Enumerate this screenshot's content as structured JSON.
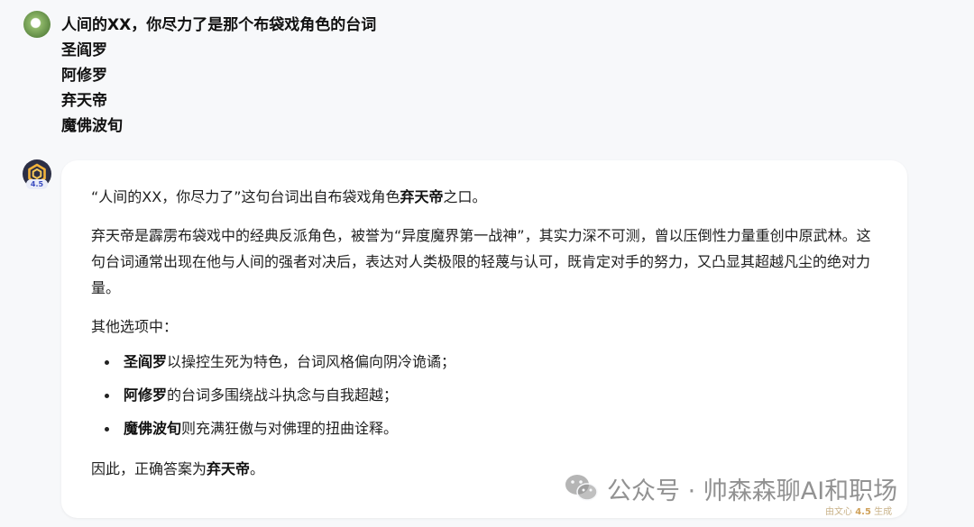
{
  "user_message": {
    "question": "人间的XX，你尽力了是那个布袋戏角色的台词",
    "options": [
      "圣阎罗",
      "阿修罗",
      "弃天帝",
      "魔佛波旬"
    ]
  },
  "bot": {
    "version_badge": "4.5",
    "answer": {
      "p1_a": "“人间的XX，你尽力了”这句台词出自布袋戏角色",
      "p1_bold": "弃天帝",
      "p1_b": "之口。",
      "p2": "弃天帝是霹雳布袋戏中的经典反派角色，被誉为“异度魔界第一战神”，其实力深不可测，曾以压倒性力量重创中原武林。这句台词通常出现在他与人间的强者对决后，表达对人类极限的轻蔑与认可，既肯定对手的努力，又凸显其超越凡尘的绝对力量。",
      "p3": "其他选项中：",
      "bullets": [
        {
          "name": "圣阎罗",
          "text": "以操控生死为特色，台词风格偏向阴冷诡谲；"
        },
        {
          "name": "阿修罗",
          "text": "的台词多围绕战斗执念与自我超越；"
        },
        {
          "name": "魔佛波旬",
          "text": "则充满狂傲与对佛理的扭曲诠释。"
        }
      ],
      "conclusion_a": "因此，正确答案为",
      "conclusion_bold": "弃天帝",
      "conclusion_b": "。"
    }
  },
  "watermark": {
    "text": "公众号 · 帅森森聊AI和职场",
    "generated_prefix": "由文心",
    "generated_version": "4.5",
    "generated_suffix": "生成"
  }
}
